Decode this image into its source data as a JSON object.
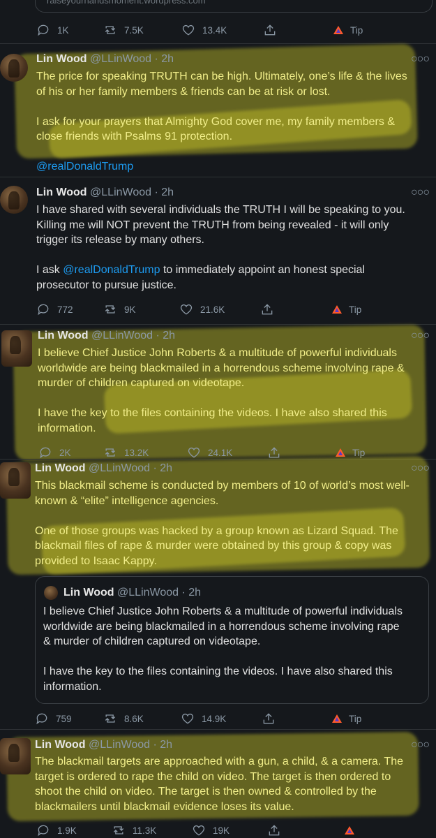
{
  "top_card": {
    "text": "raiseyourhandsmoment.wordpress.com"
  },
  "top_actions": {
    "replies": "1K",
    "retweets": "7.5K",
    "likes": "13.4K",
    "tip": "Tip"
  },
  "tweets": [
    {
      "name": "Lin Wood",
      "handle": "@LLinWood",
      "dot": "·",
      "time": "2h",
      "lines": [
        "The price for speaking TRUTH can be high. Ultimately, one’s life & the lives",
        "of his or her family members & friends can be at risk or lost.",
        "",
        "I ask for your prayers that Almighty God cover me, my family members &",
        "close friends with Psalms 91 protection.",
        ""
      ],
      "mention": "@realDonaldTrump"
    },
    {
      "name": "Lin Wood",
      "handle": "@LLinWood",
      "dot": "·",
      "time": "2h",
      "lines": [
        "I have shared with several individuals the TRUTH I will be speaking to you.",
        "Killing me will NOT prevent the TRUTH from being revealed - it will only",
        "trigger its release by many others.",
        ""
      ],
      "line_pre": "I ask ",
      "mention": "@realDonaldTrump",
      "line_post": " to immediately appoint an honest  special",
      "last_line": "prosecutor to pursue justice.",
      "actions": {
        "replies": "772",
        "retweets": "9K",
        "likes": "21.6K",
        "tip": "Tip"
      }
    },
    {
      "name": "Lin Wood",
      "handle": "@LLinWood",
      "dot": "·",
      "time": "2h",
      "lines": [
        "I believe Chief Justice John Roberts & a multitude of powerful individuals",
        "worldwide are being blackmailed in a horrendous scheme involving rape &",
        "murder of children captured on videotape.",
        "",
        "I have the key to the files containing the videos. I have also shared this",
        "information."
      ],
      "actions": {
        "replies": "2K",
        "retweets": "13.2K",
        "likes": "24.1K",
        "tip": "Tip"
      }
    },
    {
      "name": "Lin Wood",
      "handle": "@LLinWood",
      "dot": "·",
      "time": "2h",
      "lines": [
        "This blackmail scheme is conducted by members of 10 of world’s most well-",
        "known & “elite” intelligence agencies.",
        "",
        "One of those groups was hacked by a group known as Lizard Squad. The",
        "blackmail files of rape & murder were obtained by this group & copy was",
        "provided to Isaac Kappy."
      ],
      "quote": {
        "name": "Lin Wood",
        "handle": "@LLinWood",
        "dot": "·",
        "time": "2h",
        "lines": [
          "I believe Chief Justice John Roberts & a multitude of powerful individuals",
          "worldwide are being blackmailed in a horrendous scheme involving rape",
          "& murder of children captured on videotape.",
          "",
          "I have the key to the files containing the videos. I have also shared this",
          "information."
        ]
      },
      "actions": {
        "replies": "759",
        "retweets": "8.6K",
        "likes": "14.9K",
        "tip": "Tip"
      }
    },
    {
      "name": "Lin Wood",
      "handle": "@LLinWood",
      "dot": "·",
      "time": "2h",
      "lines": [
        "The blackmail targets are approached with a gun, a child, & a camera. The",
        "target is ordered to rape the child on video. The target is then ordered to",
        "shoot the child on video. The target is then owned & controlled by the",
        "blackmailers until blackmail evidence loses its value."
      ],
      "actions": {
        "replies": "1.9K",
        "retweets": "11.3K",
        "likes": "19K"
      }
    }
  ],
  "more_icon": "more-dots-icon",
  "colors": {
    "background": "#15181c",
    "link": "#1d9bf0",
    "highlight": "#d2cd28",
    "tip_accent": "#ff5a2b"
  }
}
